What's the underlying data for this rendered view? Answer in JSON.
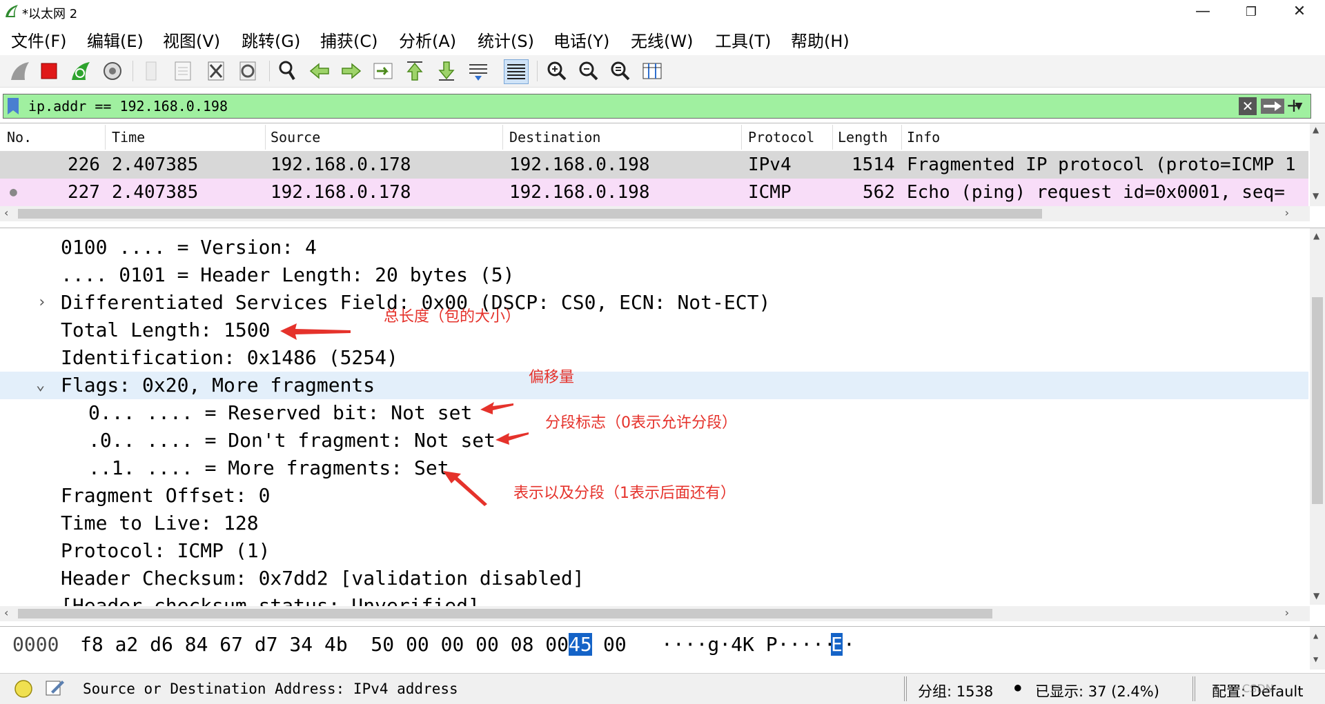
{
  "window": {
    "title": "*以太网 2",
    "minimize_icon": "minimize-icon",
    "maximize_icon": "restore-icon",
    "close_icon": "close-icon"
  },
  "menu": [
    "文件(F)",
    "编辑(E)",
    "视图(V)",
    "跳转(G)",
    "捕获(C)",
    "分析(A)",
    "统计(S)",
    "电话(Y)",
    "无线(W)",
    "工具(T)",
    "帮助(H)"
  ],
  "toolbar": {
    "icons": [
      "start-capture-icon",
      "stop-capture-icon",
      "restart-capture-icon",
      "capture-options-icon",
      "open-file-icon",
      "save-file-icon",
      "close-file-icon",
      "reload-file-icon",
      "find-packet-icon",
      "go-back-icon",
      "go-forward-icon",
      "go-to-packet-icon",
      "go-first-icon",
      "go-last-icon",
      "autoscroll-icon",
      "colorize-icon",
      "zoom-in-icon",
      "zoom-out-icon",
      "zoom-normal-icon",
      "resize-columns-icon"
    ]
  },
  "filter": {
    "value": "ip.addr == 192.168.0.198",
    "bg_color": "#a0f0a0"
  },
  "packet_list": {
    "columns": [
      "No.",
      "Time",
      "Source",
      "Destination",
      "Protocol",
      "Length",
      "Info"
    ],
    "rows": [
      {
        "no": "226",
        "time": "2.407385",
        "source": "192.168.0.178",
        "destination": "192.168.0.198",
        "protocol": "IPv4",
        "length": "1514",
        "info": "Fragmented IP protocol (proto=ICMP 1",
        "bg": "#d8d8d8"
      },
      {
        "no": "227",
        "time": "2.407385",
        "source": "192.168.0.178",
        "destination": "192.168.0.198",
        "protocol": "ICMP",
        "length": "562",
        "info": "Echo (ping) request  id=0x0001, seq=",
        "bg": "#f8ddf8"
      }
    ]
  },
  "details": {
    "lines": [
      "0100 .... = Version: 4",
      ".... 0101 = Header Length: 20 bytes (5)",
      "Differentiated Services Field: 0x00 (DSCP: CS0, ECN: Not-ECT)",
      "Total Length: 1500",
      "Identification: 0x1486 (5254)",
      "Flags: 0x20, More fragments",
      "0... .... = Reserved bit: Not set",
      ".0.. .... = Don't fragment: Not set",
      "..1. .... = More fragments: Set",
      "Fragment Offset: 0",
      "Time to Live: 128",
      "Protocol: ICMP (1)",
      "Header Checksum: 0x7dd2 [validation disabled]",
      "[Header checksum status: Unverified]"
    ],
    "annotations": [
      "总长度（包的大小）",
      "偏移量",
      "分段标志（0表示允许分段）",
      "表示以及分段（1表示后面还有）"
    ],
    "selected_bg": "#e3effa"
  },
  "bytes": {
    "offset": "0000",
    "hex_before": "f8 a2 d6 84 67 d7 34 4b  50 00 00 00 08 00",
    "hex_selected": "45",
    "hex_after": "00",
    "ascii_before": "····g·4K P·····",
    "ascii_selected": "E",
    "ascii_after": "·"
  },
  "status": {
    "field": "Source or Destination Address: IPv4 address",
    "packets": "分组: 1538",
    "displayed": "已显示: 37 (2.4%)",
    "profile": "配置: Default",
    "watermark": "CSDN"
  },
  "colors": {
    "annotation_red": "#e5322b",
    "highlight_blue": "#1463c7"
  }
}
